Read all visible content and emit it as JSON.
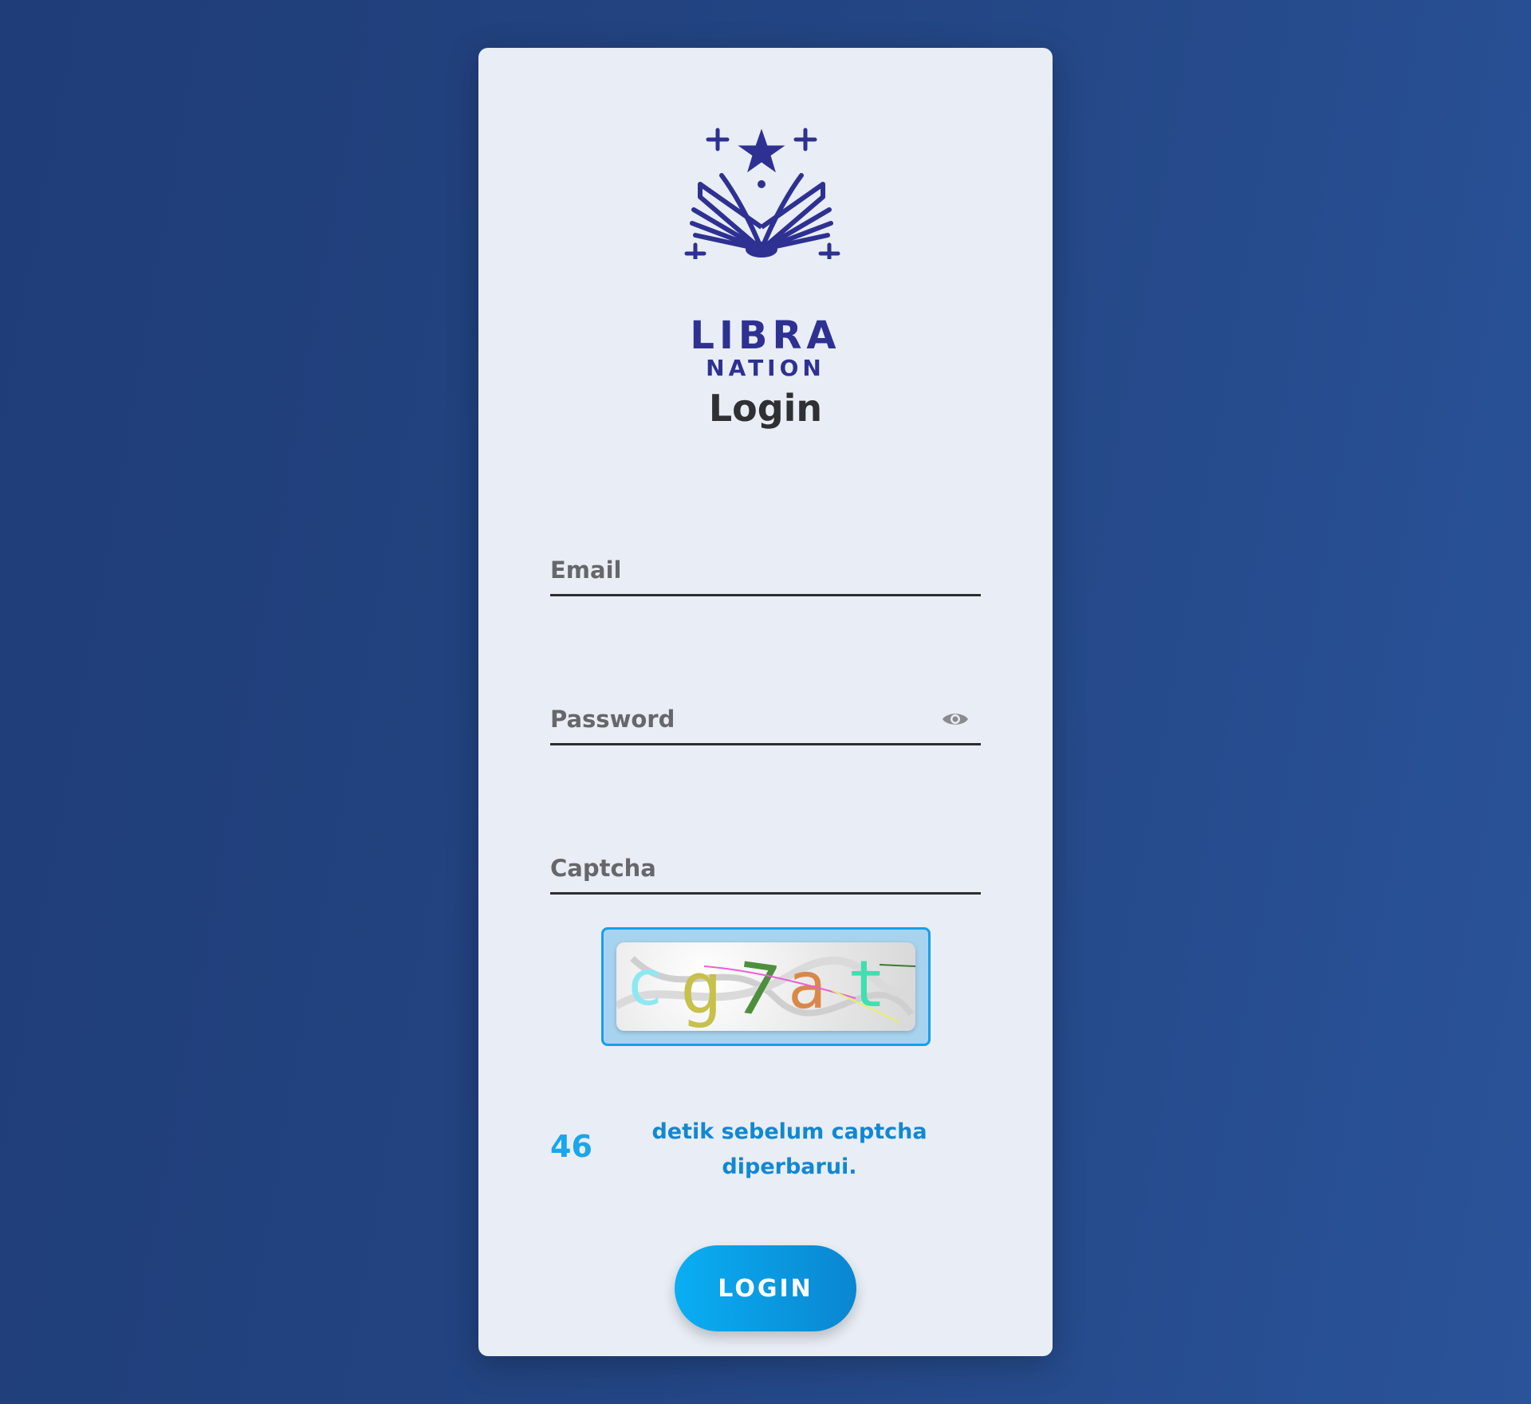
{
  "brand": {
    "name_top": "LIBRA",
    "name_bottom": "NATION",
    "color": "#2e3192"
  },
  "form": {
    "title": "Login",
    "email_placeholder": "Email",
    "password_placeholder": "Password",
    "captcha_placeholder": "Captcha",
    "captcha_image_text": "cg7at",
    "countdown_seconds": "46",
    "countdown_line1": "detik sebelum captcha",
    "countdown_line2": "diperbarui.",
    "login_label": "LOGIN"
  },
  "icons": {
    "password_toggle": "eye-icon",
    "logo": "open-book-star-icon"
  },
  "colors": {
    "background": "#234583",
    "card": "#e9edf5",
    "accent": "#0aaef3",
    "countdown": "#1aa6ea"
  }
}
